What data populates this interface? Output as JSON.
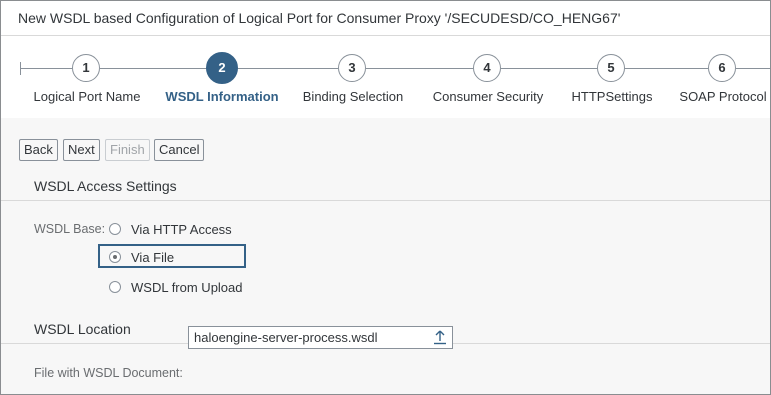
{
  "window": {
    "title": "New WSDL based Configuration of Logical Port for Consumer Proxy '/SECUDESD/CO_HENG67'"
  },
  "roadmap": {
    "active_step": 2,
    "steps": [
      {
        "number": "1",
        "label": "Logical Port Name"
      },
      {
        "number": "2",
        "label": "WSDL Information"
      },
      {
        "number": "3",
        "label": "Binding Selection"
      },
      {
        "number": "4",
        "label": "Consumer Security"
      },
      {
        "number": "5",
        "label": "HTTPSettings"
      },
      {
        "number": "6",
        "label": "SOAP Protocol"
      }
    ]
  },
  "toolbar": {
    "back_label": "Back",
    "next_label": "Next",
    "finish_label": "Finish",
    "cancel_label": "Cancel"
  },
  "access_settings": {
    "title": "WSDL Access Settings",
    "wsdl_base_label": "WSDL Base:",
    "options": [
      {
        "label": "Via HTTP Access",
        "checked": false
      },
      {
        "label": "Via File",
        "checked": true
      },
      {
        "label": "WSDL from Upload",
        "checked": false
      }
    ]
  },
  "location": {
    "title": "WSDL Location",
    "file_label": "File with WSDL Document:",
    "file_value": "haloengine-server-process.wsdl"
  },
  "colors": {
    "accent": "#346187",
    "border": "#89919a",
    "text": "#32363a"
  },
  "icons": {
    "upload": "upload-icon"
  }
}
